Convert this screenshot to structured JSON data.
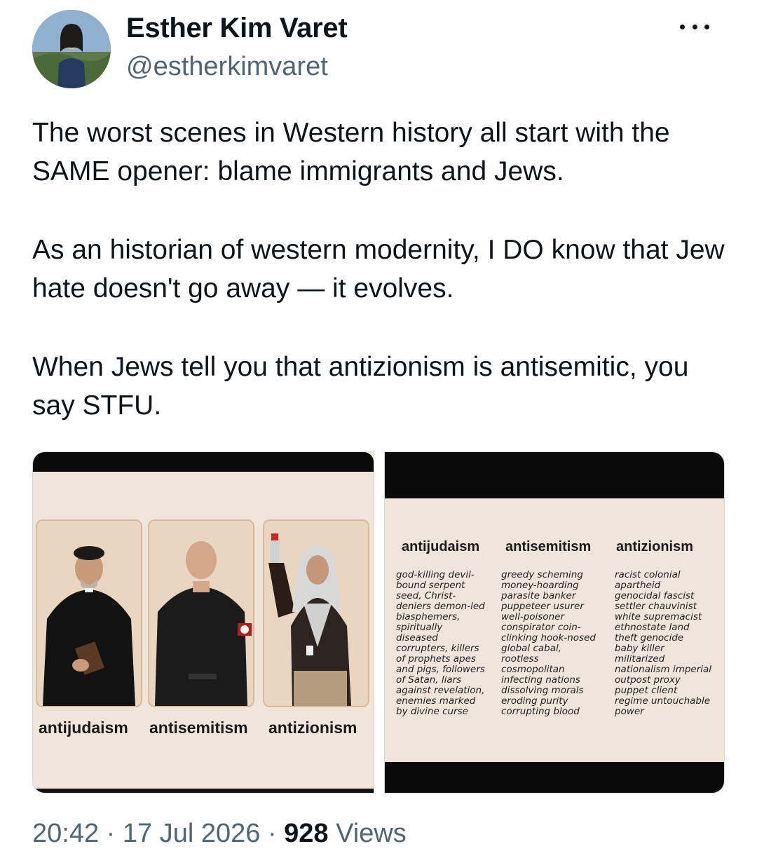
{
  "author": {
    "display_name": "Esther Kim Varet",
    "handle": "@estherkimvaret"
  },
  "tweet": {
    "paragraphs": [
      "The worst scenes in Western history all start with the SAME opener: blame immigrants and Jews.",
      "As an historian of western modernity, I DO know that Jew hate doesn't go away — it evolves.",
      "When Jews tell you that antizionism is antisemitic, you say STFU."
    ]
  },
  "media_left": {
    "captions": [
      "antijudaism",
      "antisemitism",
      "antizionism"
    ]
  },
  "media_right": {
    "headings": [
      "antijudaism",
      "antisemitism",
      "antizionism"
    ],
    "columns": [
      [
        "god-killing devil-",
        "bound serpent",
        "seed, Christ-",
        "deniers demon-led",
        "blasphemers,",
        "spiritually",
        "diseased",
        "corrupters, killers",
        "of prophets apes",
        "and pigs, followers",
        "of Satan, liars",
        "against revelation,",
        "enemies marked",
        "by divine curse"
      ],
      [
        "greedy scheming",
        "money-hoarding",
        "parasite banker",
        "puppeteer usurer",
        "well-poisoner",
        "conspirator coin-",
        "clinking hook-nosed",
        "global cabal,",
        "rootless",
        "cosmopolitan",
        "infecting nations",
        "dissolving morals",
        "eroding purity",
        "corrupting blood"
      ],
      [
        "racist colonial",
        "apartheid",
        "genocidal fascist",
        "settler chauvinist",
        "white supremacist",
        "ethnostate land",
        "theft genocide",
        "baby killer",
        "militarized",
        "nationalism imperial",
        "outpost proxy",
        "puppet client",
        "regime untouchable",
        "power"
      ]
    ]
  },
  "meta": {
    "time": "20:42",
    "separator": "·",
    "date": "17 Jul 2026",
    "views_count": "928",
    "views_label": "Views"
  }
}
